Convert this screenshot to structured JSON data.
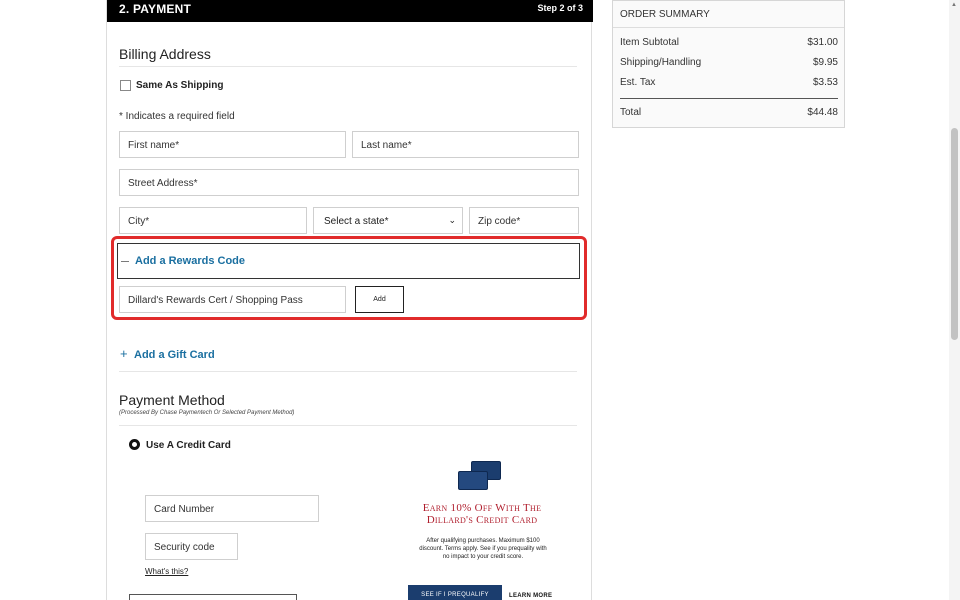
{
  "step": {
    "title": "2. PAYMENT",
    "count": "Step 2 of 3"
  },
  "billing": {
    "heading": "Billing Address",
    "same_as_shipping": "Same As Shipping",
    "required_note": "* Indicates a required field",
    "first_name": "First name*",
    "last_name": "Last name*",
    "street": "Street Address*",
    "city": "City*",
    "state": "Select a state*",
    "zip": "Zip code*"
  },
  "rewards": {
    "title": "Add a Rewards Code",
    "input_placeholder": "Dillard's Rewards Cert / Shopping Pass",
    "add_label": "Add"
  },
  "gift_card": {
    "title": "Add a Gift Card"
  },
  "payment": {
    "heading": "Payment Method",
    "subheading": "(Processed By Chase Paymentech Or Selected Payment Method)",
    "credit_card_label": "Use A Credit Card",
    "card_number": "Card Number",
    "security_code": "Security code",
    "whats_this": "What's this?"
  },
  "promo": {
    "title_line1": "Earn 10% Off With The",
    "title_line2": "Dillard's Credit Card",
    "text": "After qualifying purchases. Maximum $100 discount. Terms apply. See if you prequality with no impact to your credit score.",
    "prequal_button": "SEE IF I PREQUALIFY",
    "learn_more": "LEARN MORE"
  },
  "summary": {
    "title": "ORDER SUMMARY",
    "rows": [
      {
        "label": "Item Subtotal",
        "value": "$31.00"
      },
      {
        "label": "Shipping/Handling",
        "value": "$9.95"
      },
      {
        "label": "Est. Tax",
        "value": "$3.53"
      }
    ],
    "total_label": "Total",
    "total_value": "$44.48"
  },
  "colors": {
    "link": "#1a6fa0",
    "highlight": "#e12b2b",
    "promo_red": "#b01e2d",
    "card_navy": "#1b3d6e"
  },
  "icons": [
    "checkbox-icon",
    "minus-icon",
    "plus-icon",
    "radio-icon",
    "chevron-down-icon",
    "credit-card-icon"
  ]
}
